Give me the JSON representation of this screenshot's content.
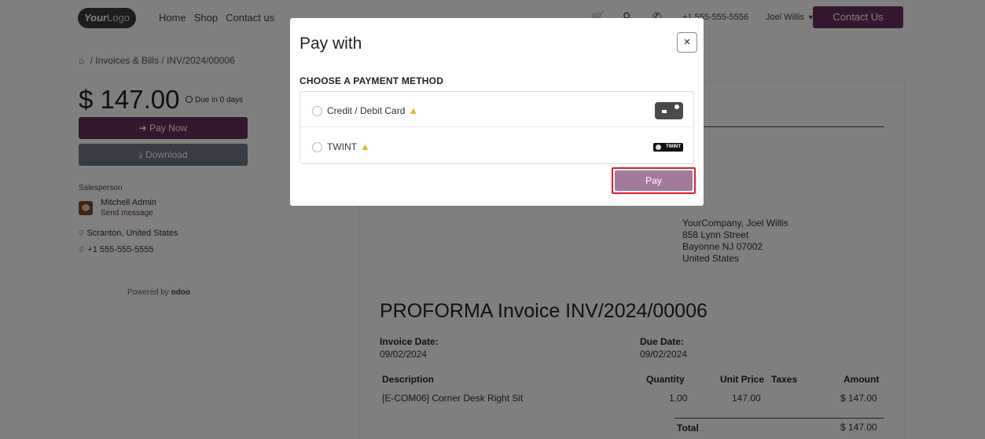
{
  "header": {
    "logo": {
      "part1": "Your",
      "part2": "Logo"
    },
    "nav": [
      "Home",
      "Shop",
      "Contact us"
    ],
    "phone": "+1 555-555-5556",
    "user": "Joel Willis",
    "contact_button": "Contact Us"
  },
  "breadcrumb": {
    "items": [
      "Invoices & Bills",
      "INV/2024/00006"
    ],
    "sep": "/"
  },
  "summary": {
    "amount": "$ 147.00",
    "due": "Due in 0 days",
    "pay_now": "Pay Now",
    "download": "Download"
  },
  "salesperson": {
    "label": "Salesperson",
    "name": "Mitchell Admin",
    "send_message": "Send message",
    "location": "Scranton, United States",
    "phone": "+1 555-555-5555"
  },
  "powered": {
    "text": "Powered by",
    "brand": "odoo"
  },
  "invoice": {
    "address": [
      "YourCompany, Joel Willis",
      "858 Lynn Street",
      "Bayonne NJ 07002",
      "United States"
    ],
    "title": "PROFORMA Invoice INV/2024/00006",
    "invoice_date_label": "Invoice Date:",
    "invoice_date": "09/02/2024",
    "due_date_label": "Due Date:",
    "due_date": "09/02/2024",
    "columns": {
      "description": "Description",
      "quantity": "Quantity",
      "unit_price": "Unit Price",
      "taxes": "Taxes",
      "amount": "Amount"
    },
    "line": {
      "description": "[E-COM06] Corner Desk Right Sit",
      "quantity": "1.00",
      "unit_price": "147.00",
      "amount": "$ 147.00"
    },
    "total_label": "Total",
    "total": "$ 147.00"
  },
  "modal": {
    "title": "Pay with",
    "close": "×",
    "section_title": "CHOOSE A PAYMENT METHOD",
    "methods": [
      {
        "label": "Credit / Debit Card",
        "icon": "credit-card-icon"
      },
      {
        "label": "TWINT",
        "icon": "twint-logo-icon",
        "logo_text": "TWINT"
      }
    ],
    "pay_button": "Pay"
  },
  "colors": {
    "brand": "#6a2f60",
    "secondary": "#6f7a84",
    "warning": "#f0b429",
    "highlight": "#d91e2b",
    "pay_disabled": "#a27b9a"
  }
}
